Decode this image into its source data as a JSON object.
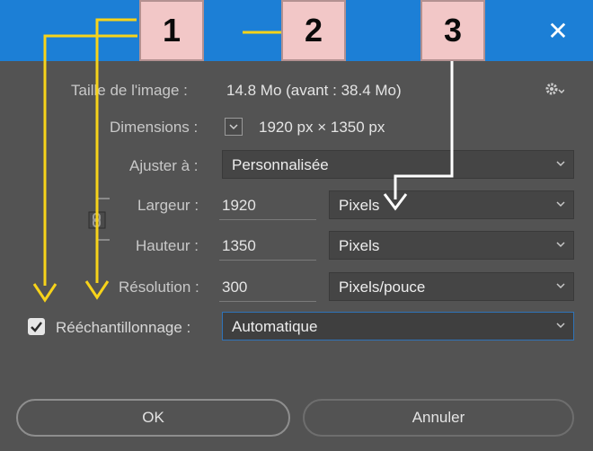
{
  "dialog": {
    "close_glyph": "✕",
    "image_size_label": "Taille de l'image :",
    "image_size_value": "14.8 Mo (avant : 38.4 Mo)",
    "dimensions_label": "Dimensions :",
    "dimensions_value": "1920 px  ×  1350 px",
    "fit_label": "Ajuster à :",
    "fit_value": "Personnalisée",
    "width_label": "Largeur :",
    "width_value": "1920",
    "width_unit": "Pixels",
    "height_label": "Hauteur :",
    "height_value": "1350",
    "height_unit": "Pixels",
    "resolution_label": "Résolution :",
    "resolution_value": "300",
    "resolution_unit": "Pixels/pouce",
    "resample_label": "Rééchantillonnage :",
    "resample_checked": true,
    "resample_value": "Automatique",
    "ok_label": "OK",
    "cancel_label": "Annuler"
  },
  "annotations": {
    "badges": [
      "1",
      "2",
      "3"
    ],
    "arrow_yellow": "#f7d31a",
    "arrow_white": "#ffffff",
    "badge_fill": "#f2c7c7"
  },
  "colors": {
    "titlebar": "#1c7fd6",
    "background": "#535353"
  },
  "icons": {
    "close": "close-icon",
    "settings": "gear-icon",
    "link": "link-icon",
    "dropdown": "chevron-down-icon",
    "checkbox": "checkmark-icon"
  }
}
